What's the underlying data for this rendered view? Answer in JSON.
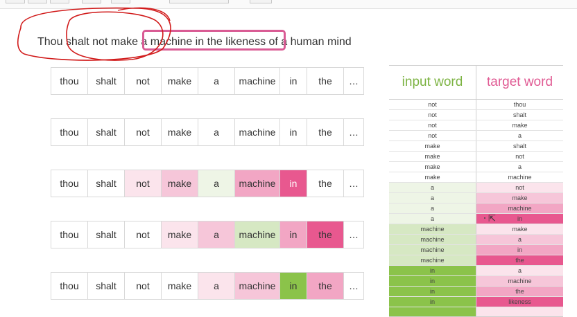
{
  "colors": {
    "input_header": "#7cb342",
    "target_header": "#e05a93",
    "highlight_box": "#d95b94",
    "ink": "#d11b1b"
  },
  "sentence": {
    "text": "Thou shalt not make a machine in the likeness of a human mind"
  },
  "sequences": [
    {
      "cells": [
        {
          "word": "thou",
          "bg": "#ffffff",
          "fg": "#333333"
        },
        {
          "word": "shalt",
          "bg": "#ffffff",
          "fg": "#333333"
        },
        {
          "word": "not",
          "bg": "#ffffff",
          "fg": "#333333"
        },
        {
          "word": "make",
          "bg": "#ffffff",
          "fg": "#333333"
        },
        {
          "word": "a",
          "bg": "#ffffff",
          "fg": "#333333"
        },
        {
          "word": "machine",
          "bg": "#ffffff",
          "fg": "#333333"
        },
        {
          "word": "in",
          "bg": "#ffffff",
          "fg": "#333333"
        },
        {
          "word": "the",
          "bg": "#ffffff",
          "fg": "#333333"
        },
        {
          "word": "…",
          "bg": "#ffffff",
          "fg": "#333333"
        }
      ]
    },
    {
      "cells": [
        {
          "word": "thou",
          "bg": "#ffffff",
          "fg": "#333333"
        },
        {
          "word": "shalt",
          "bg": "#ffffff",
          "fg": "#333333"
        },
        {
          "word": "not",
          "bg": "#ffffff",
          "fg": "#333333"
        },
        {
          "word": "make",
          "bg": "#ffffff",
          "fg": "#333333"
        },
        {
          "word": "a",
          "bg": "#ffffff",
          "fg": "#333333"
        },
        {
          "word": "machine",
          "bg": "#ffffff",
          "fg": "#333333"
        },
        {
          "word": "in",
          "bg": "#ffffff",
          "fg": "#333333"
        },
        {
          "word": "the",
          "bg": "#ffffff",
          "fg": "#333333"
        },
        {
          "word": "…",
          "bg": "#ffffff",
          "fg": "#333333"
        }
      ]
    },
    {
      "cells": [
        {
          "word": "thou",
          "bg": "#ffffff",
          "fg": "#333333"
        },
        {
          "word": "shalt",
          "bg": "#ffffff",
          "fg": "#333333"
        },
        {
          "word": "not",
          "bg": "#fbe4ec",
          "fg": "#333333"
        },
        {
          "word": "make",
          "bg": "#f6c6d9",
          "fg": "#333333"
        },
        {
          "word": "a",
          "bg": "#eef5e6",
          "fg": "#333333"
        },
        {
          "word": "machine",
          "bg": "#f2a6c4",
          "fg": "#333333"
        },
        {
          "word": "in",
          "bg": "#e8588f",
          "fg": "#ffffff"
        },
        {
          "word": "the",
          "bg": "#ffffff",
          "fg": "#333333"
        },
        {
          "word": "…",
          "bg": "#ffffff",
          "fg": "#333333"
        }
      ]
    },
    {
      "cells": [
        {
          "word": "thou",
          "bg": "#ffffff",
          "fg": "#333333"
        },
        {
          "word": "shalt",
          "bg": "#ffffff",
          "fg": "#333333"
        },
        {
          "word": "not",
          "bg": "#ffffff",
          "fg": "#333333"
        },
        {
          "word": "make",
          "bg": "#fbe4ec",
          "fg": "#333333"
        },
        {
          "word": "a",
          "bg": "#f6c6d9",
          "fg": "#333333"
        },
        {
          "word": "machine",
          "bg": "#d6e8c3",
          "fg": "#333333"
        },
        {
          "word": "in",
          "bg": "#f2a6c4",
          "fg": "#333333"
        },
        {
          "word": "the",
          "bg": "#e8588f",
          "fg": "#333333"
        },
        {
          "word": "…",
          "bg": "#ffffff",
          "fg": "#333333"
        }
      ]
    },
    {
      "cells": [
        {
          "word": "thou",
          "bg": "#ffffff",
          "fg": "#333333"
        },
        {
          "word": "shalt",
          "bg": "#ffffff",
          "fg": "#333333"
        },
        {
          "word": "not",
          "bg": "#ffffff",
          "fg": "#333333"
        },
        {
          "word": "make",
          "bg": "#ffffff",
          "fg": "#333333"
        },
        {
          "word": "a",
          "bg": "#fbe4ec",
          "fg": "#333333"
        },
        {
          "word": "machine",
          "bg": "#f6c6d9",
          "fg": "#333333"
        },
        {
          "word": "in",
          "bg": "#8bc34a",
          "fg": "#333333"
        },
        {
          "word": "the",
          "bg": "#f2a6c4",
          "fg": "#333333"
        },
        {
          "word": "…",
          "bg": "#ffffff",
          "fg": "#333333"
        }
      ]
    }
  ],
  "table": {
    "header_input": "input word",
    "header_target": "target word",
    "rows": [
      {
        "input": "not",
        "target": "thou",
        "ibg": "#ffffff",
        "tbg": "#ffffff"
      },
      {
        "input": "not",
        "target": "shalt",
        "ibg": "#ffffff",
        "tbg": "#ffffff"
      },
      {
        "input": "not",
        "target": "make",
        "ibg": "#ffffff",
        "tbg": "#ffffff"
      },
      {
        "input": "not",
        "target": "a",
        "ibg": "#ffffff",
        "tbg": "#ffffff"
      },
      {
        "input": "make",
        "target": "shalt",
        "ibg": "#ffffff",
        "tbg": "#ffffff"
      },
      {
        "input": "make",
        "target": "not",
        "ibg": "#ffffff",
        "tbg": "#ffffff"
      },
      {
        "input": "make",
        "target": "a",
        "ibg": "#ffffff",
        "tbg": "#ffffff"
      },
      {
        "input": "make",
        "target": "machine",
        "ibg": "#ffffff",
        "tbg": "#ffffff"
      },
      {
        "input": "a",
        "target": "not",
        "ibg": "#eef5e6",
        "tbg": "#fbe4ec"
      },
      {
        "input": "a",
        "target": "make",
        "ibg": "#eef5e6",
        "tbg": "#f6c6d9"
      },
      {
        "input": "a",
        "target": "machine",
        "ibg": "#eef5e6",
        "tbg": "#f2a6c4"
      },
      {
        "input": "a",
        "target": "in",
        "ibg": "#eef5e6",
        "tbg": "#e8588f"
      },
      {
        "input": "machine",
        "target": "make",
        "ibg": "#d6e8c3",
        "tbg": "#fbe4ec"
      },
      {
        "input": "machine",
        "target": "a",
        "ibg": "#d6e8c3",
        "tbg": "#f6c6d9"
      },
      {
        "input": "machine",
        "target": "in",
        "ibg": "#d6e8c3",
        "tbg": "#f2a6c4"
      },
      {
        "input": "machine",
        "target": "the",
        "ibg": "#d6e8c3",
        "tbg": "#e8588f"
      },
      {
        "input": "in",
        "target": "a",
        "ibg": "#8bc34a",
        "tbg": "#fbe4ec"
      },
      {
        "input": "in",
        "target": "machine",
        "ibg": "#8bc34a",
        "tbg": "#f6c6d9"
      },
      {
        "input": "in",
        "target": "the",
        "ibg": "#8bc34a",
        "tbg": "#f2a6c4"
      },
      {
        "input": "in",
        "target": "likeness",
        "ibg": "#8bc34a",
        "tbg": "#e8588f"
      }
    ],
    "footer": {
      "ibg": "#8bc34a",
      "tbg": "#fbe4ec"
    }
  }
}
